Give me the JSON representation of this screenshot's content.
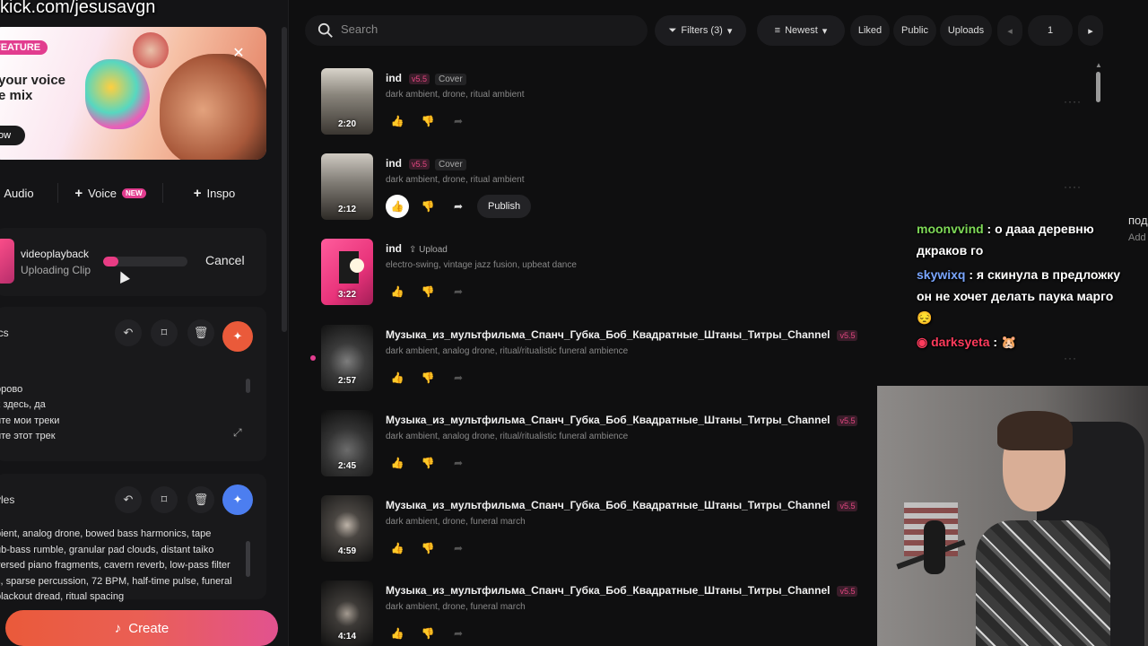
{
  "watermark": "kick.com/jesusavgn",
  "banner": {
    "badge": "FEATURE",
    "title": "your voice\ne mix",
    "button": "ow",
    "close": "✕"
  },
  "add_row": {
    "audio": "Audio",
    "voice": "Voice",
    "voice_badge": "NEW",
    "inspo": "Inspo",
    "plus": "+"
  },
  "upload": {
    "name": "videoplayback",
    "status": "Uploading Clip",
    "progress": 0.18,
    "cancel": "Cancel"
  },
  "lyrics": {
    "title": "ics",
    "lines": [
      "]",
      "орово",
      "х здесь, да",
      "йте мои треки",
      "йте этот трек"
    ]
  },
  "styles": {
    "title": "yles",
    "lines": [
      "bient, analog drone, bowed bass harmonics, tape",
      "ub-bass rumble, granular pad clouds, distant taiko",
      "versed piano fragments, cavern reverb, low-pass filter",
      "s, sparse percussion, 72 BPM, half-time pulse, funeral",
      "blackout dread, ritual spacing"
    ]
  },
  "create": {
    "label": "Create"
  },
  "search": {
    "placeholder": "Search"
  },
  "filters": {
    "filters_label": "Filters (3)",
    "sort_label": "Newest",
    "liked": "Liked",
    "public": "Public",
    "uploads": "Uploads",
    "page": "1"
  },
  "tracks": [
    {
      "title": "ind",
      "version": "v5.5",
      "badge": "Cover",
      "tags": "dark ambient, drone, ritual ambient",
      "duration": "2:20"
    },
    {
      "title": "ind",
      "version": "v5.5",
      "badge": "Cover",
      "tags": "dark ambient, drone, ritual ambient",
      "duration": "2:12",
      "publish": "Publish"
    },
    {
      "title": "ind",
      "badge": "Upload",
      "tags": "electro-swing, vintage jazz fusion, upbeat dance",
      "duration": "3:22"
    },
    {
      "title": "Музыка_из_мультфильма_Спанч_Губка_Боб_Квадратные_Штаны_Титры_Channel",
      "version": "v5.5",
      "tags": "dark ambient, analog drone, ritual/ritualistic funeral ambience",
      "duration": "2:57"
    },
    {
      "title": "Музыка_из_мультфильма_Спанч_Губка_Боб_Квадратные_Штаны_Титры_Channel",
      "version": "v5.5",
      "tags": "dark ambient, analog drone, ritual/ritualistic funeral ambience",
      "duration": "2:45"
    },
    {
      "title": "Музыка_из_мультфильма_Спанч_Губка_Боб_Квадратные_Штаны_Титры_Channel",
      "version": "v5.5",
      "tags": "dark ambient, drone, funeral march",
      "duration": "4:59"
    },
    {
      "title": "Музыка_из_мультфильма_Спанч_Губка_Боб_Квадратные_Штаны_Титры_Channel",
      "version": "v5.5",
      "tags": "dark ambient, drone, funeral march",
      "duration": "4:14"
    }
  ],
  "chat": [
    {
      "user": "moonvvind",
      "user_color": "#7ed957",
      "message": " : о дааа деревню дкраков го"
    },
    {
      "user": "skywixq",
      "user_color": "#7aa6ff",
      "message": " : я скинула в предложку он не хочет делать паука марго 😔"
    },
    {
      "user": "darksyeta",
      "user_color": "#ff3b5c",
      "message": " : 🐹"
    }
  ],
  "chat_edge": {
    "top": "под",
    "sub": "Add"
  },
  "colors": {
    "accent_pink": "#e23d8f",
    "accent_orange": "#ea5a3a",
    "accent_blue": "#4c7ef0"
  }
}
